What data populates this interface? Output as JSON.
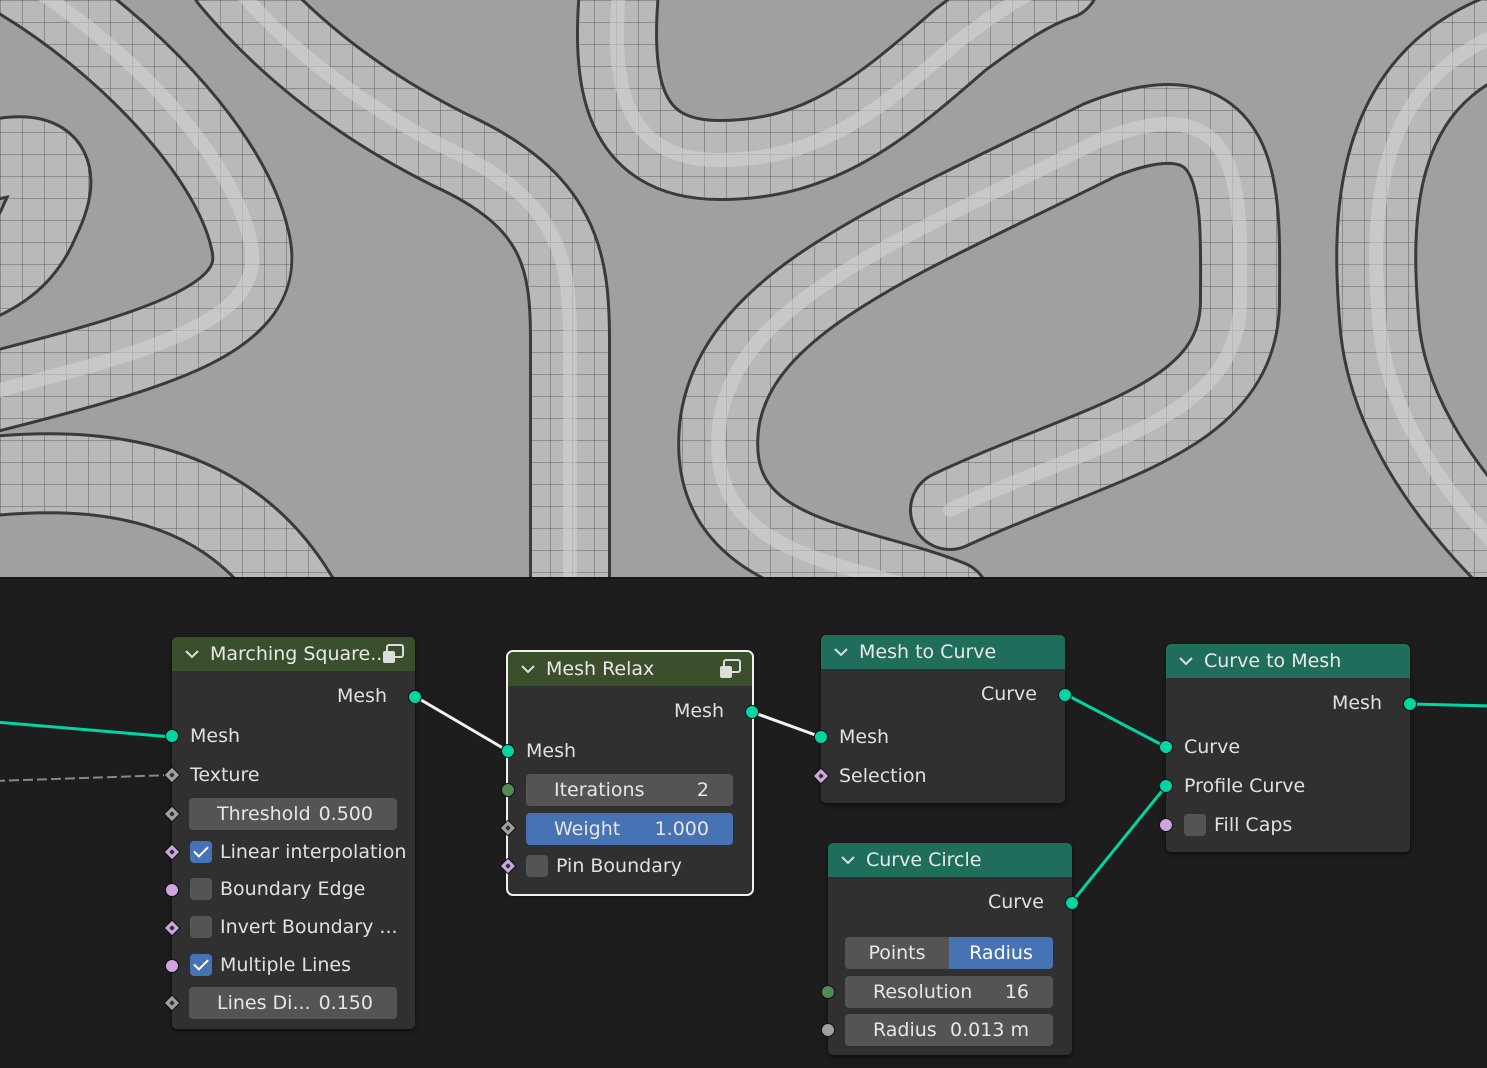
{
  "viewport": {
    "background": "#a0a0a0",
    "mesh_color": "#b8b8b8"
  },
  "nodes": {
    "marching": {
      "title": "Marching Square...",
      "out_mesh": "Mesh",
      "in_mesh": "Mesh",
      "in_texture": "Texture",
      "threshold_label": "Threshold",
      "threshold_value": "0.500",
      "linear_label": "Linear interpolation",
      "linear_checked": true,
      "boundary_label": "Boundary Edge",
      "invert_label": "Invert Boundary ...",
      "multiple_label": "Multiple Lines",
      "multiple_checked": true,
      "lines_label": "Lines Di...",
      "lines_value": "0.150"
    },
    "relax": {
      "title": "Mesh Relax",
      "out_mesh": "Mesh",
      "in_mesh": "Mesh",
      "iterations_label": "Iterations",
      "iterations_value": "2",
      "weight_label": "Weight",
      "weight_value": "1.000",
      "pin_label": "Pin Boundary"
    },
    "mesh_to_curve": {
      "title": "Mesh to Curve",
      "out_curve": "Curve",
      "in_mesh": "Mesh",
      "in_selection": "Selection"
    },
    "curve_to_mesh": {
      "title": "Curve to Mesh",
      "out_mesh": "Mesh",
      "in_curve": "Curve",
      "in_profile": "Profile Curve",
      "fill_caps_label": "Fill Caps"
    },
    "curve_circle": {
      "title": "Curve Circle",
      "out_curve": "Curve",
      "mode_points": "Points",
      "mode_radius": "Radius",
      "resolution_label": "Resolution",
      "resolution_value": "16",
      "radius_label": "Radius",
      "radius_value": "0.013 m"
    }
  },
  "colors": {
    "geometry_socket": "#00d6a3",
    "boolean_socket": "#cda6de",
    "integer_socket": "#548b55",
    "float_socket": "#a1a1a1",
    "geometry_node_header": "#3b4f2d",
    "curve_node_header": "#1f6e5c",
    "active_field": "#4772b3"
  }
}
